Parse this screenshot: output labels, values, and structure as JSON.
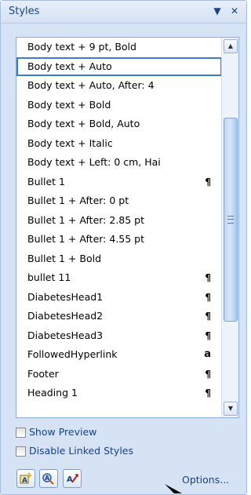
{
  "pane": {
    "title": "Styles",
    "dropdown_glyph": "▼",
    "close_glyph": "✕"
  },
  "styles_list": [
    {
      "label": "Body text + 9 pt, Bold",
      "glyph": ""
    },
    {
      "label": "Body text + Auto",
      "glyph": "",
      "selected": true
    },
    {
      "label": "Body text + Auto, After:  4",
      "glyph": ""
    },
    {
      "label": "Body text + Bold",
      "glyph": ""
    },
    {
      "label": "Body text + Bold, Auto",
      "glyph": ""
    },
    {
      "label": "Body text + Italic",
      "glyph": ""
    },
    {
      "label": "Body text + Left:  0 cm, Hai",
      "glyph": ""
    },
    {
      "label": "Bullet 1",
      "glyph": "¶"
    },
    {
      "label": "Bullet 1 + After:  0 pt",
      "glyph": ""
    },
    {
      "label": "Bullet 1 + After:  2.85 pt",
      "glyph": ""
    },
    {
      "label": "Bullet 1 + After:  4.55 pt",
      "glyph": ""
    },
    {
      "label": "Bullet 1 + Bold",
      "glyph": ""
    },
    {
      "label": "bullet 11",
      "glyph": "¶"
    },
    {
      "label": "DiabetesHead1",
      "glyph": "¶"
    },
    {
      "label": "DiabetesHead2",
      "glyph": "¶"
    },
    {
      "label": "DiabetesHead3",
      "glyph": "¶"
    },
    {
      "label": "FollowedHyperlink",
      "glyph": "a"
    },
    {
      "label": "Footer",
      "glyph": "¶"
    },
    {
      "label": "Heading 1",
      "glyph": "¶"
    }
  ],
  "scrollbar": {
    "up_glyph": "▲",
    "down_glyph": "▼"
  },
  "options": {
    "show_preview": {
      "label": "Show Preview",
      "checked": false
    },
    "disable_linked_styles": {
      "label": "Disable Linked Styles",
      "checked": false
    }
  },
  "footer": {
    "buttons": [
      {
        "icon": "new-style-icon"
      },
      {
        "icon": "style-inspector-icon"
      },
      {
        "icon": "manage-styles-icon"
      }
    ],
    "options_link": "Options..."
  },
  "colors": {
    "pane_bg": "#d6e3f5",
    "accent_text": "#15428b",
    "selection_border": "#3a7bd5"
  }
}
